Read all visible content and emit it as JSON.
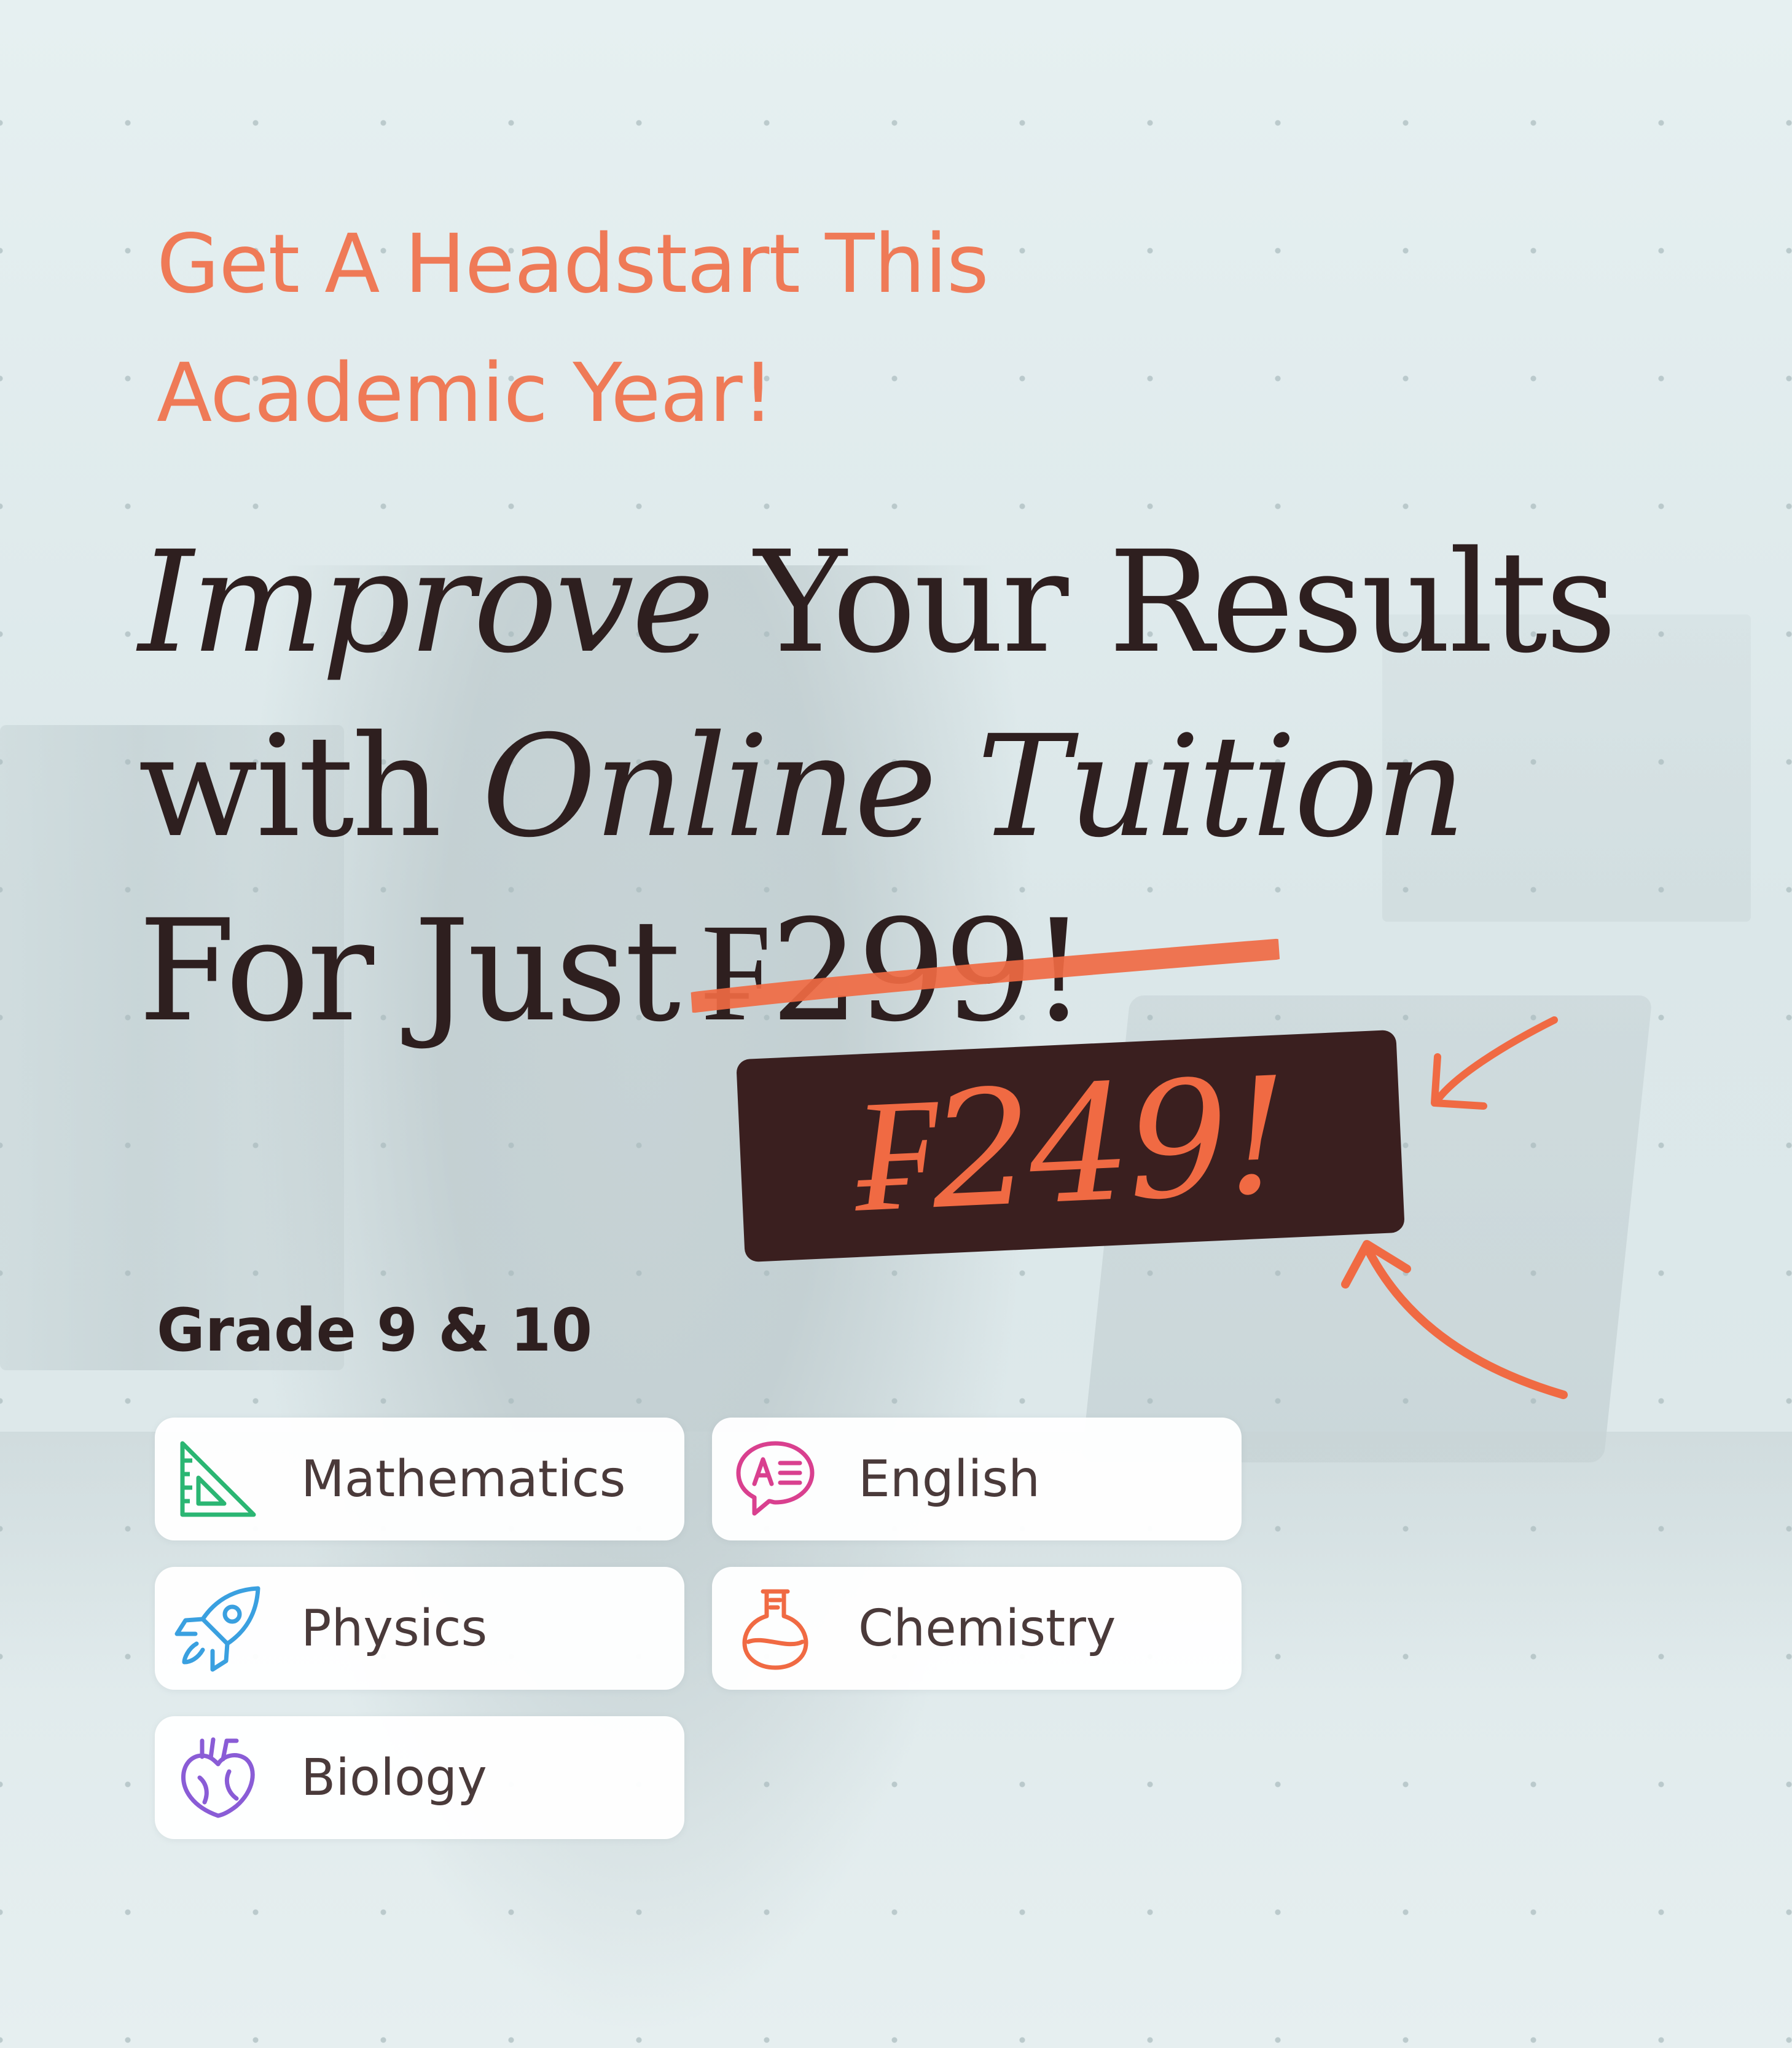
{
  "kicker": {
    "line1": "Get A Headstart This",
    "line2": "Academic Year!"
  },
  "headline": {
    "line1_italic": "Improve",
    "line1_rest": " Your Results",
    "line2_start": "with ",
    "line2_italic": "Online Tuition",
    "line3_start": "For Just",
    "old_price": "₣299!"
  },
  "new_price": "₣249!",
  "grade": "Grade 9 & 10",
  "subjects": [
    {
      "label": "Mathematics",
      "icon": "set-square-icon",
      "color": "#2bb673"
    },
    {
      "label": "English",
      "icon": "speech-bubble-text-icon",
      "color": "#d9408f"
    },
    {
      "label": "Physics",
      "icon": "rocket-icon",
      "color": "#3aa0e0"
    },
    {
      "label": "Chemistry",
      "icon": "flask-icon",
      "color": "#f06a43"
    },
    {
      "label": "Biology",
      "icon": "heart-organ-icon",
      "color": "#8a5cd6"
    }
  ],
  "colors": {
    "accent": "#ef7a57",
    "dark": "#3a1f1f",
    "text": "#2e1f1f"
  }
}
